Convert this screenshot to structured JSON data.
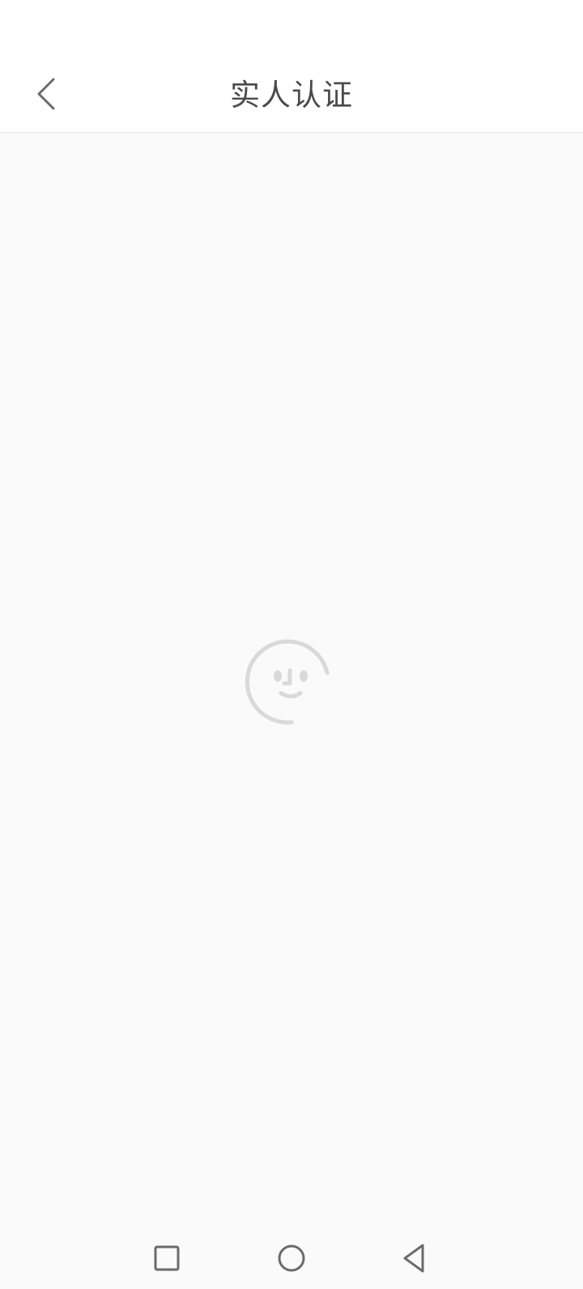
{
  "header": {
    "title": "实人认证",
    "back_icon": "chevron-left-icon"
  },
  "content": {
    "loader_icon": "face-scan-loading-icon"
  },
  "nav_bar": {
    "recents_icon": "square-icon",
    "home_icon": "circle-icon",
    "back_icon": "triangle-back-icon"
  },
  "colors": {
    "header_bg": "#ffffff",
    "content_bg": "#fafafa",
    "title_text": "#4a4a4a",
    "icon_gray": "#6b6b6b",
    "loader_gray": "#d9d9d9"
  }
}
